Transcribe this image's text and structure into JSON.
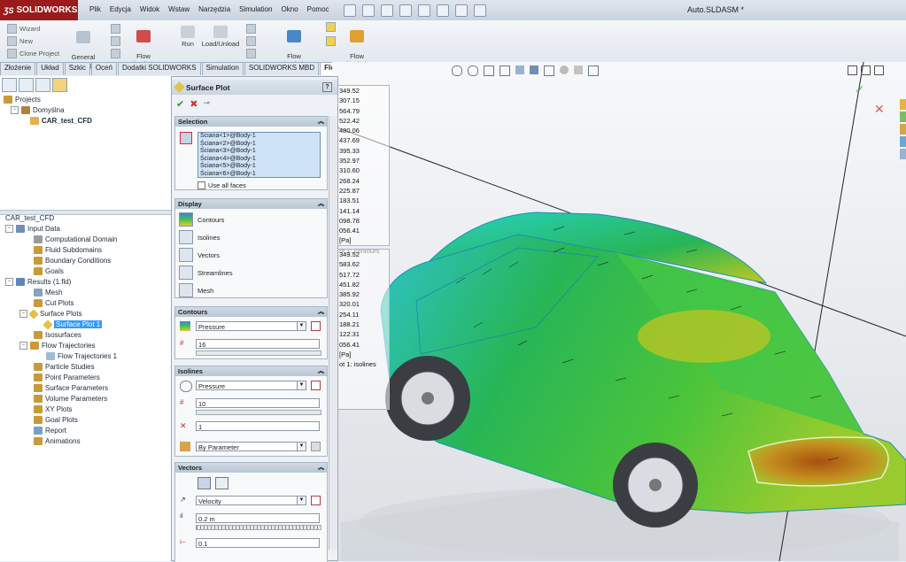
{
  "app": {
    "brand": "SOLIDWORKS",
    "doc_title": "Auto.SLDASM *",
    "menu": [
      "Plik",
      "Edycja",
      "Widok",
      "Wstaw",
      "Narzędzia",
      "Simulation",
      "Okno",
      "Pomoc"
    ]
  },
  "ribbon": {
    "small_items": [
      "Wizard",
      "New",
      "Clone Project"
    ],
    "general_settings": "General\nSettings",
    "flow_sim1": "Flow\nSimulati...",
    "run": "Run",
    "load_unload": "Load/Unload",
    "flow_sim2": "Flow\nSimulati...",
    "flow_sim3": "Flow\nSimulati..."
  },
  "tabs": [
    "Złożenie",
    "Układ",
    "Szkic",
    "Oceń",
    "Dodatki SOLIDWORKS",
    "Simulation",
    "SOLIDWORKS MBD",
    "Flow Simulation"
  ],
  "active_tab": "Flow Simulation",
  "tree_top": {
    "projects": "Projects",
    "config": "Domyślna",
    "project": "CAR_test_CFD"
  },
  "tree": {
    "root": "CAR_test_CFD",
    "input_data": "Input Data",
    "computational_domain": "Computational Domain",
    "fluid_subdomains": "Fluid Subdomains",
    "boundary_conditions": "Boundary Conditions",
    "goals": "Goals",
    "results": "Results (1.fld)",
    "mesh": "Mesh",
    "cut_plots": "Cut Plots",
    "surface_plots": "Surface Plots",
    "surface_plot_1": "Surface Plot 1",
    "isosurfaces": "Isosurfaces",
    "flow_trajectories": "Flow Trajectories",
    "flow_trajectories_1": "Flow Trajectories 1",
    "particle_studies": "Particle Studies",
    "point_parameters": "Point Parameters",
    "surface_parameters": "Surface Parameters",
    "volume_parameters": "Volume Parameters",
    "xy_plots": "XY Plots",
    "goal_plots": "Goal Plots",
    "report": "Report",
    "animations": "Animations"
  },
  "pm": {
    "title": "Surface Plot",
    "help": "?",
    "selection": {
      "header": "Selection",
      "faces": [
        "Ściana<1>@Body-1",
        "Ściana<2>@Body-1",
        "Ściana<3>@Body-1",
        "Ściana<4>@Body-1",
        "Ściana<5>@Body-1",
        "Ściana<6>@Body-1"
      ],
      "use_all_faces": "Use all faces"
    },
    "display": {
      "header": "Display",
      "items": [
        "Contours",
        "Isolines",
        "Vectors",
        "Streamlines",
        "Mesh"
      ]
    },
    "contours": {
      "header": "Contours",
      "parameter": "Pressure",
      "levels": "16"
    },
    "isolines": {
      "header": "Isolines",
      "parameter": "Pressure",
      "levels": "10",
      "width": "1",
      "color_mode": "By Parameter"
    },
    "vectors": {
      "header": "Vectors",
      "parameter": "Velocity",
      "spacing": "0.2 m",
      "length": "0.1"
    }
  },
  "legend_contours": {
    "values": [
      "349.52",
      "307.15",
      "564.79",
      "522.42",
      "480.06",
      "437.69",
      "395.33",
      "352.97",
      "310.60",
      "268.24",
      "225.87",
      "183.51",
      "141.14",
      "098.78",
      "056.41"
    ],
    "unit": "[Pa]",
    "caption": "ot 1: contours"
  },
  "legend_isolines": {
    "values": [
      "349.52",
      "583.62",
      "517.72",
      "451.82",
      "385.92",
      "320.01",
      "254.11",
      "188.21",
      "122.31",
      "056.41"
    ],
    "unit": "[Pa]",
    "caption": "ot 1: isolines"
  },
  "colors": {
    "brand_red": "#9a1b1b",
    "selection_blue": "#3399ff",
    "contour_low": "#1fb4d8",
    "contour_mid": "#3ac24a",
    "contour_high": "#b86a10"
  }
}
